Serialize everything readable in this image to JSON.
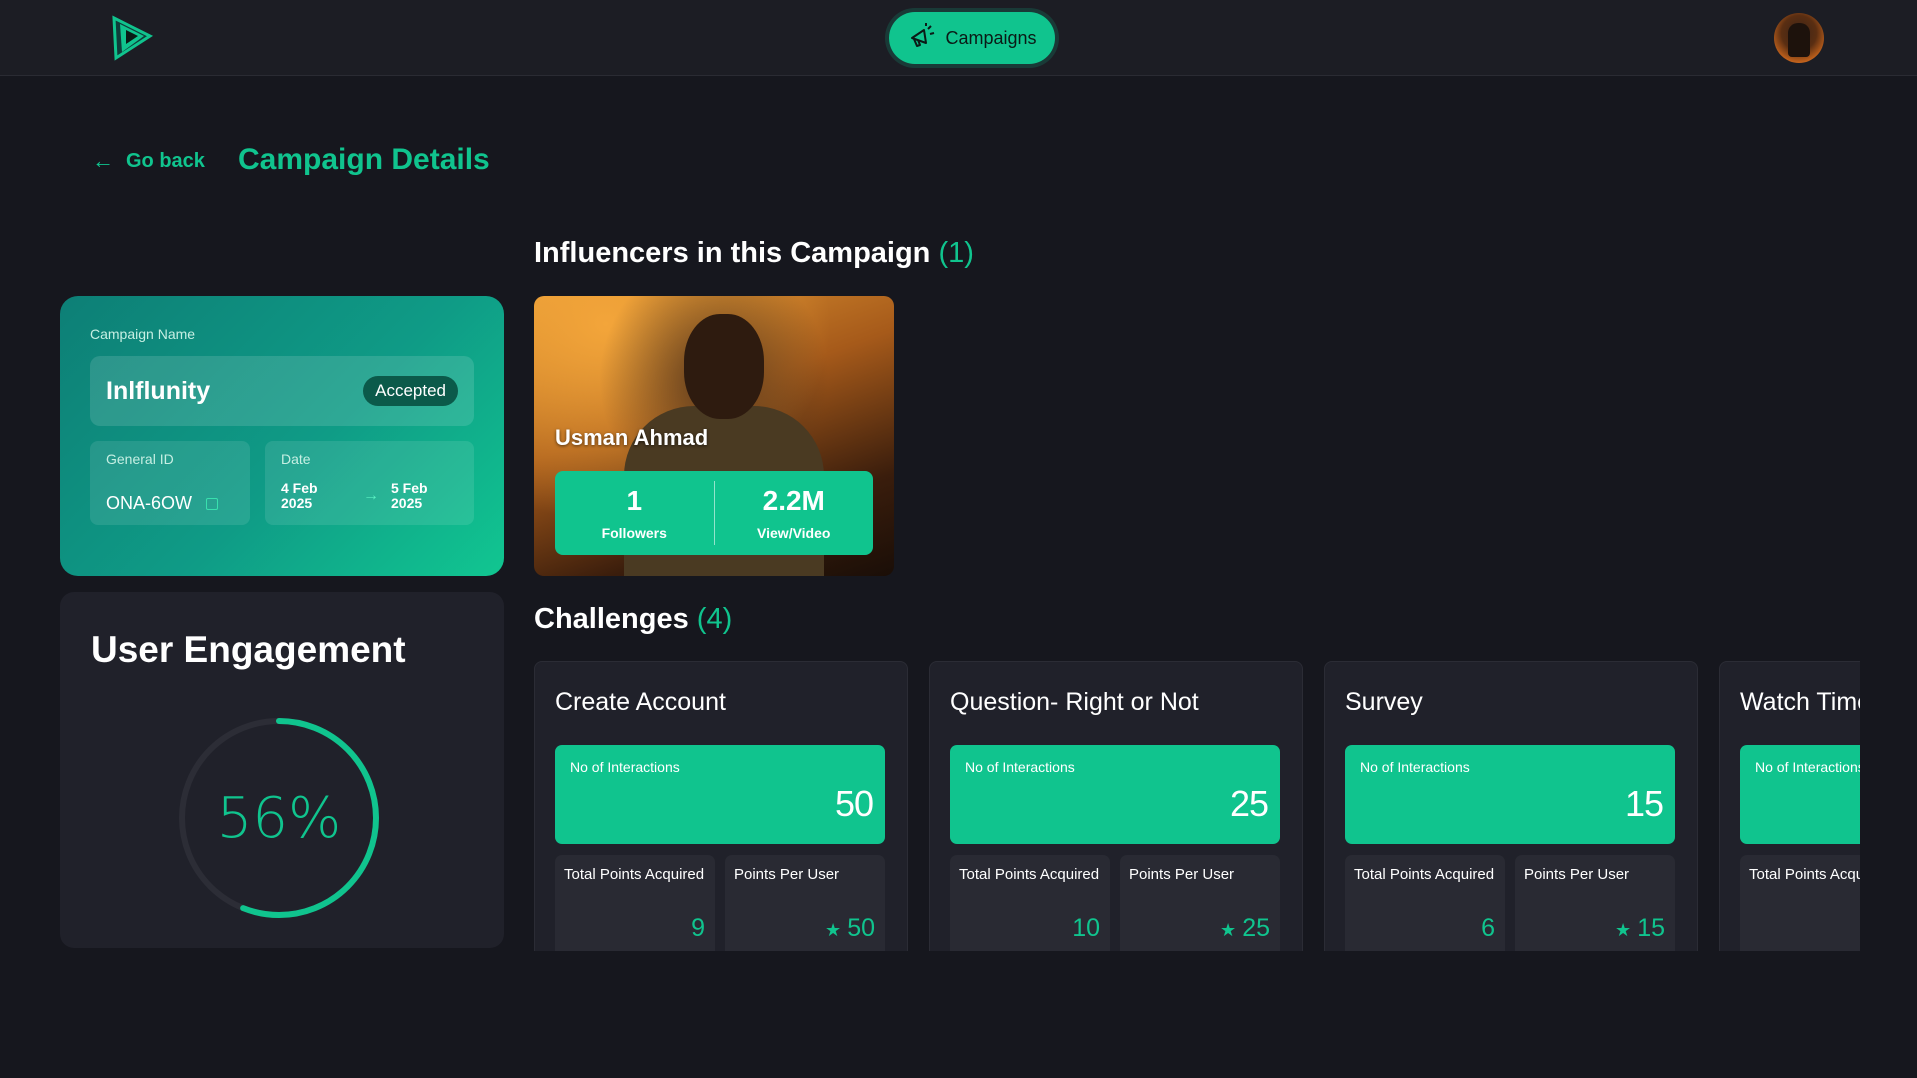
{
  "header": {
    "campaigns_label": "Campaigns"
  },
  "nav": {
    "go_back": "Go back",
    "page_title": "Campaign Details"
  },
  "campaign": {
    "name_label": "Campaign Name",
    "name": "Inlflunity",
    "status": "Accepted",
    "general_id_label": "General ID",
    "general_id": "ONA-6OW",
    "date_label": "Date",
    "start_date": "4 Feb 2025",
    "end_date": "5 Feb 2025"
  },
  "engagement": {
    "title": "User Engagement",
    "percent_label": "56%",
    "percent": 56
  },
  "influencers": {
    "title": "Influencers in this Campaign",
    "count": "(1)",
    "items": [
      {
        "name": "Usman Ahmad",
        "followers": "1",
        "followers_label": "Followers",
        "views": "2.2M",
        "views_label": "View/Video"
      }
    ]
  },
  "challenges": {
    "title": "Challenges",
    "count": "(4)",
    "interactions_label": "No of Interactions",
    "total_points_label": "Total Points Acquired",
    "points_per_user_label": "Points Per User",
    "items": [
      {
        "title": "Create Account",
        "interactions": "50",
        "total_points": "9",
        "points_per_user": "50"
      },
      {
        "title": "Question- Right or Not",
        "interactions": "25",
        "total_points": "10",
        "points_per_user": "25"
      },
      {
        "title": "Survey",
        "interactions": "15",
        "total_points": "6",
        "points_per_user": "15"
      },
      {
        "title": "Watch Time",
        "interactions": "",
        "total_points": "",
        "points_per_user": ""
      }
    ]
  },
  "colors": {
    "accent": "#10c48e",
    "background": "#16171e",
    "card": "#20212a"
  }
}
